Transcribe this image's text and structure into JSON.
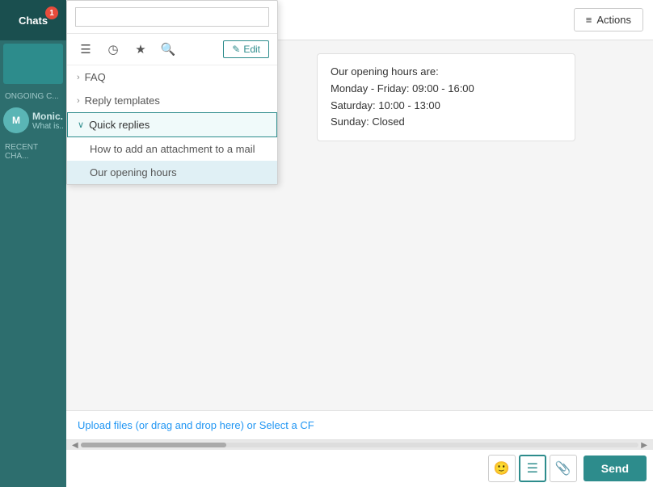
{
  "sidebar": {
    "chats_label": "Chats",
    "badge": "1",
    "ongoing_label": "ONGOING C...",
    "recent_label": "RECENT CHA...",
    "chat_name": "Monic...",
    "chat_preview": "What is..."
  },
  "topbar": {
    "actions_label": "Actions",
    "actions_icon": "≡"
  },
  "message": {
    "line1": "Our opening hours are:",
    "line2": "Monday - Friday: 09:00 - 16:00",
    "line3": "Saturday: 10:00 - 13:00",
    "line4": "Sunday: Closed"
  },
  "input": {
    "upload_text": "Upload files (or drag and drop here) or Select a CF",
    "send_label": "Send"
  },
  "dropdown": {
    "search_placeholder": "",
    "edit_label": "Edit",
    "edit_icon": "✎",
    "menu_icon": "☰",
    "clock_icon": "◷",
    "star_icon": "★",
    "search_icon": "🔍",
    "items": [
      {
        "id": "faq",
        "label": "FAQ",
        "expanded": false,
        "chevron": "›"
      },
      {
        "id": "reply-templates",
        "label": "Reply templates",
        "expanded": false,
        "chevron": "›"
      },
      {
        "id": "quick-replies",
        "label": "Quick replies",
        "expanded": true,
        "chevron": "∨"
      }
    ],
    "subitems": [
      {
        "id": "how-to-add",
        "label": "How to add an attachment to a mail"
      },
      {
        "id": "opening-hours",
        "label": "Our opening hours",
        "selected": true
      }
    ]
  }
}
